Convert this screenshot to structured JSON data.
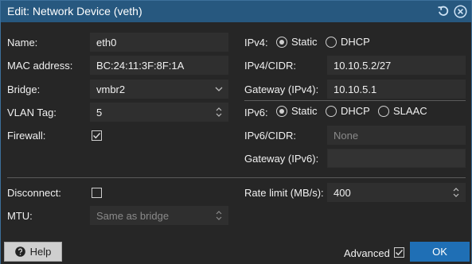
{
  "window": {
    "title": "Edit: Network Device (veth)"
  },
  "left": {
    "name_label": "Name:",
    "name_value": "eth0",
    "mac_label": "MAC address:",
    "mac_value": "BC:24:11:3F:8F:1A",
    "bridge_label": "Bridge:",
    "bridge_value": "vmbr2",
    "vlan_label": "VLAN Tag:",
    "vlan_value": "5",
    "firewall_label": "Firewall:",
    "firewall_checked": true
  },
  "right": {
    "ipv4_label": "IPv4:",
    "ipv4_static": "Static",
    "ipv4_dhcp": "DHCP",
    "ipv4_selected": "Static",
    "ipv4cidr_label": "IPv4/CIDR:",
    "ipv4cidr_value": "10.10.5.2/27",
    "gw4_label": "Gateway (IPv4):",
    "gw4_value": "10.10.5.1",
    "ipv6_label": "IPv6:",
    "ipv6_static": "Static",
    "ipv6_dhcp": "DHCP",
    "ipv6_slaac": "SLAAC",
    "ipv6_selected": "Static",
    "ipv6cidr_label": "IPv6/CIDR:",
    "ipv6cidr_placeholder": "None",
    "gw6_label": "Gateway (IPv6):",
    "gw6_value": ""
  },
  "advanced": {
    "disconnect_label": "Disconnect:",
    "disconnect_checked": false,
    "mtu_label": "MTU:",
    "mtu_placeholder": "Same as bridge",
    "rate_label": "Rate limit (MB/s):",
    "rate_value": "400"
  },
  "footer": {
    "help_label": "Help",
    "advanced_label": "Advanced",
    "advanced_checked": true,
    "ok_label": "OK"
  },
  "icons": {
    "reset": "reset-icon",
    "close": "close-icon",
    "help": "question-circle-icon",
    "dropdown": "chevron-down-icon",
    "spinner": "spinner-icon",
    "check": "check-icon"
  },
  "colors": {
    "titlebar": "#27587f",
    "accent": "#1f6fb5",
    "background": "#262626",
    "field": "#2f2f2f"
  }
}
